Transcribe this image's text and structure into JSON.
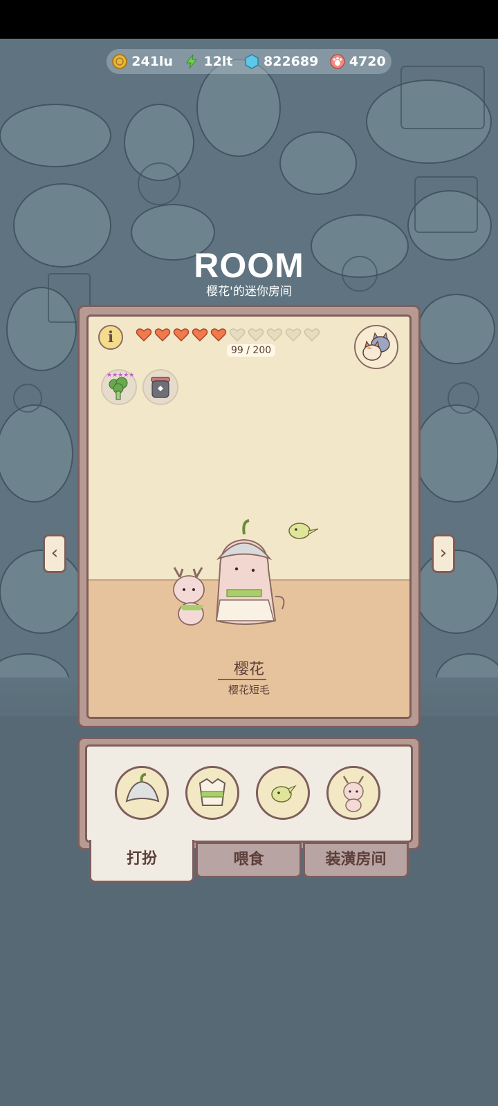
{
  "currency": [
    {
      "icon": "coin-icon",
      "value": "241lu",
      "color": "#e9b640"
    },
    {
      "icon": "lightning-icon",
      "value": "12lt",
      "color": "#6fd04a"
    },
    {
      "icon": "gem-icon",
      "value": "822689",
      "color": "#5fc8e8"
    },
    {
      "icon": "paw-icon",
      "value": "4720",
      "color": "#f08a80"
    }
  ],
  "room": {
    "title": "ROOM",
    "subtitle": "樱花'的迷你房间"
  },
  "card": {
    "info_label": "i",
    "hearts_filled": 5,
    "hearts_total": 10,
    "love_count": "99 / 200",
    "cat_name": "樱花",
    "cat_breed": "樱花短毛"
  },
  "nav": {
    "prev": "‹",
    "next": "›"
  },
  "outfit_slots": [
    "hat-slot",
    "clothes-slot",
    "bird-slot",
    "deer-slot"
  ],
  "tabs": [
    {
      "label": "打扮",
      "active": true
    },
    {
      "label": "喂食",
      "active": false
    },
    {
      "label": "装潢房间",
      "active": false
    }
  ],
  "colors": {
    "heart": "#f07a4c",
    "heart_empty": "#e6dcc0",
    "frame": "#7d5e5c"
  }
}
